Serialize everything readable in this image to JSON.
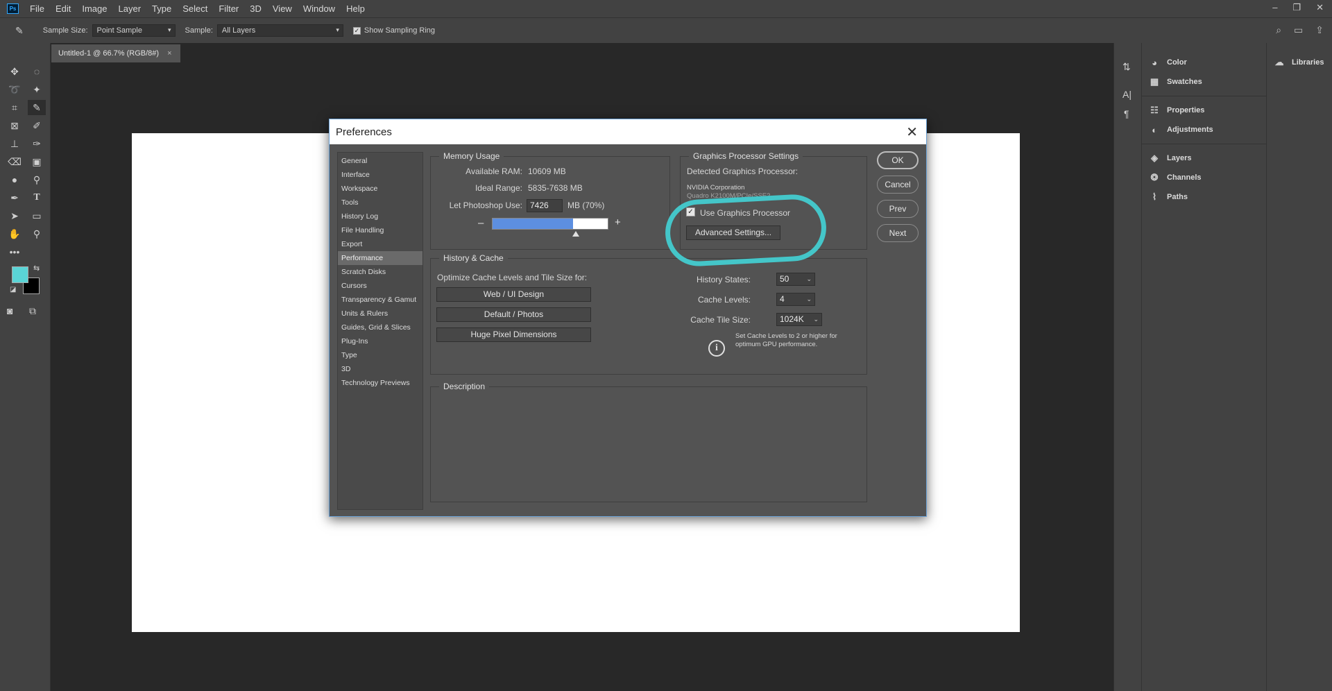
{
  "app": {
    "logo": "Ps"
  },
  "menu": [
    "File",
    "Edit",
    "Image",
    "Layer",
    "Type",
    "Select",
    "Filter",
    "3D",
    "View",
    "Window",
    "Help"
  ],
  "window_controls": {
    "minimize": "–",
    "restore": "❐",
    "close": "✕"
  },
  "options_bar": {
    "tool_icon": "eyedropper-icon",
    "sample_size_label": "Sample Size:",
    "sample_size_value": "Point Sample",
    "sample_label": "Sample:",
    "sample_value": "All Layers",
    "show_ring_label": "Show Sampling Ring",
    "show_ring_checked": true
  },
  "document": {
    "tab_title": "Untitled-1 @ 66.7% (RGB/8#)",
    "tab_close": "×"
  },
  "colors": {
    "foreground": "#5ad4d6",
    "background": "#000000",
    "highlight": "#44c6c9",
    "selection_blue": "#5d8fe0"
  },
  "right_panels": {
    "group1": [
      {
        "label": "Color",
        "icon": "color-wheel-icon"
      },
      {
        "label": "Swatches",
        "icon": "grid-icon"
      }
    ],
    "group2": [
      {
        "label": "Properties",
        "icon": "properties-icon"
      },
      {
        "label": "Adjustments",
        "icon": "adjustments-icon"
      }
    ],
    "group3": [
      {
        "label": "Layers",
        "icon": "layers-icon"
      },
      {
        "label": "Channels",
        "icon": "channels-icon"
      },
      {
        "label": "Paths",
        "icon": "paths-icon"
      }
    ],
    "libraries": "Libraries"
  },
  "dialog": {
    "title": "Preferences",
    "categories": [
      "General",
      "Interface",
      "Workspace",
      "Tools",
      "History Log",
      "File Handling",
      "Export",
      "Performance",
      "Scratch Disks",
      "Cursors",
      "Transparency & Gamut",
      "Units & Rulers",
      "Guides, Grid & Slices",
      "Plug-Ins",
      "Type",
      "3D",
      "Technology Previews"
    ],
    "selected_category": "Performance",
    "memory": {
      "title": "Memory Usage",
      "available_label": "Available RAM:",
      "available_value": "10609 MB",
      "ideal_label": "Ideal Range:",
      "ideal_value": "5835-7638 MB",
      "use_label": "Let Photoshop Use:",
      "use_value": "7426",
      "use_unit": "MB (70%)",
      "percent": 70,
      "minus": "–",
      "plus": "+"
    },
    "gpu": {
      "title": "Graphics Processor Settings",
      "detected_label": "Detected Graphics Processor:",
      "vendor": "NVIDIA Corporation",
      "model": "Quadro K2100M/PCIe/SSE2",
      "use_gpu_label": "Use Graphics Processor",
      "use_gpu_checked": true,
      "advanced_button": "Advanced Settings..."
    },
    "history": {
      "title": "History & Cache",
      "optimize_label": "Optimize Cache Levels and Tile Size for:",
      "buttons": [
        "Web / UI Design",
        "Default / Photos",
        "Huge Pixel Dimensions"
      ],
      "history_states_label": "History States:",
      "history_states_value": "50",
      "cache_levels_label": "Cache Levels:",
      "cache_levels_value": "4",
      "tile_size_label": "Cache Tile Size:",
      "tile_size_value": "1024K",
      "info_text_1": "Set Cache Levels to 2 or higher for",
      "info_text_2": "optimum GPU performance."
    },
    "description": {
      "title": "Description"
    },
    "buttons": {
      "ok": "OK",
      "cancel": "Cancel",
      "prev": "Prev",
      "next": "Next"
    }
  }
}
